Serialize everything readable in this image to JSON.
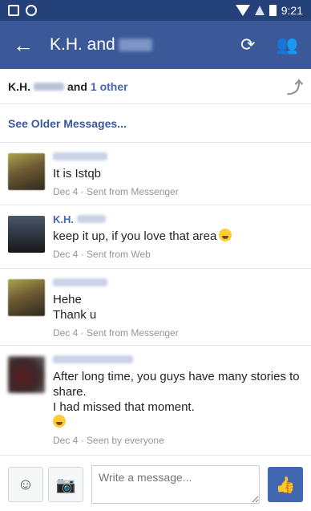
{
  "status_bar": {
    "time": "9:21"
  },
  "header": {
    "back_icon": "←",
    "title": "K.H. and",
    "refresh_icon": "⟳",
    "people_icon": "👥"
  },
  "participants": {
    "name": "K.H.",
    "and": "and",
    "other": "1 other",
    "share_icon": "⤴"
  },
  "older_messages": "See Older Messages...",
  "messages": [
    {
      "sender": "",
      "text": "It is Istqb",
      "meta": "Dec 4 · Sent from Messenger"
    },
    {
      "sender": "K.H.",
      "text": "keep it up, if you love that area",
      "meta": "Dec 4 · Sent from Web"
    },
    {
      "sender": "",
      "text_lines": [
        "Hehe",
        "Thank u"
      ],
      "meta": "Dec 4 · Sent from Messenger"
    },
    {
      "sender": "",
      "text_lines": [
        "After long time, you guys have many stories to share.",
        "I had missed that moment."
      ],
      "meta": "Dec 4 · Seen by everyone"
    }
  ],
  "composer": {
    "placeholder": "Write a message...",
    "emoji_icon": "☺",
    "camera_icon": "📷",
    "like_icon": "👍"
  }
}
